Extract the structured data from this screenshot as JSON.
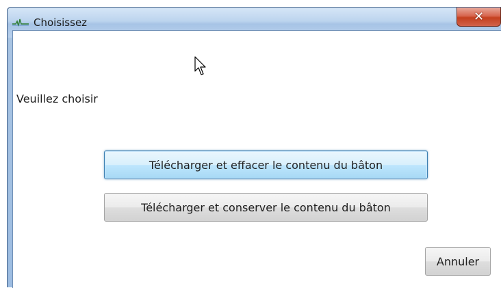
{
  "window": {
    "title": "Choisissez",
    "icon": "wave-signal-icon",
    "close_icon": "close-icon"
  },
  "dialog": {
    "prompt": "Veuillez choisir",
    "buttons": {
      "download_erase": "Télécharger et effacer le contenu du bâton",
      "download_keep": "Télécharger et conserver le contenu du bâton",
      "cancel": "Annuler"
    }
  },
  "colors": {
    "title_bar": "#bcd4ee",
    "close_button": "#c4401f",
    "focus_border": "#3c7fb1"
  }
}
